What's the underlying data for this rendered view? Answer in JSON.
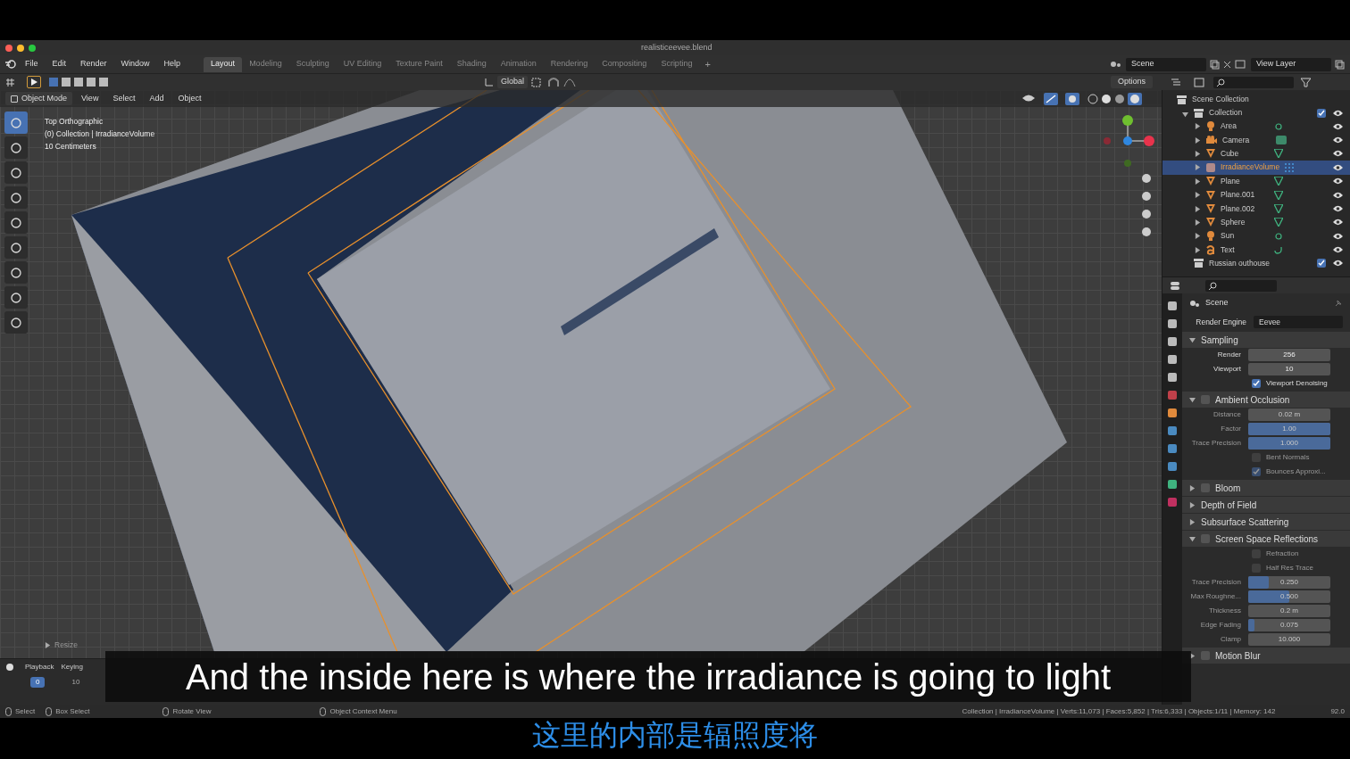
{
  "window": {
    "title": "realisticeevee.blend"
  },
  "menus": [
    "File",
    "Edit",
    "Render",
    "Window",
    "Help"
  ],
  "workspace_tabs": [
    {
      "label": "Layout",
      "selected": true
    },
    {
      "label": "Modeling",
      "selected": false
    },
    {
      "label": "Sculpting",
      "selected": false
    },
    {
      "label": "UV Editing",
      "selected": false
    },
    {
      "label": "Texture Paint",
      "selected": false
    },
    {
      "label": "Shading",
      "selected": false
    },
    {
      "label": "Animation",
      "selected": false
    },
    {
      "label": "Rendering",
      "selected": false
    },
    {
      "label": "Compositing",
      "selected": false
    },
    {
      "label": "Scripting",
      "selected": false
    }
  ],
  "add_tab": "+",
  "scene_field": "Scene",
  "view_layer_field": "View Layer",
  "tool_header": {
    "orientation": "Global",
    "options": "Options"
  },
  "viewport_header": {
    "mode": "Object Mode",
    "menus": [
      "View",
      "Select",
      "Add",
      "Object"
    ]
  },
  "viewport_info": [
    "Top Orthographic",
    "(0) Collection | IrradianceVolume",
    "10 Centimeters"
  ],
  "last_operator": "Resize",
  "timeline": {
    "menus": [
      "Playback",
      "Keying"
    ],
    "current_frame": "0",
    "frame_label": "10"
  },
  "outliner": {
    "root": "Scene Collection",
    "collections": [
      {
        "name": "Collection",
        "expanded": true,
        "checked": true,
        "children": [
          {
            "name": "Area",
            "kind": "light",
            "selected": false
          },
          {
            "name": "Camera",
            "kind": "camera",
            "selected": false
          },
          {
            "name": "Cube",
            "kind": "mesh",
            "selected": false
          },
          {
            "name": "IrradianceVolume",
            "kind": "probe",
            "selected": true
          },
          {
            "name": "Plane",
            "kind": "mesh",
            "selected": false
          },
          {
            "name": "Plane.001",
            "kind": "mesh",
            "selected": false
          },
          {
            "name": "Plane.002",
            "kind": "mesh",
            "selected": false
          },
          {
            "name": "Sphere",
            "kind": "mesh",
            "selected": false
          },
          {
            "name": "Sun",
            "kind": "light",
            "selected": false
          },
          {
            "name": "Text",
            "kind": "text",
            "selected": false
          }
        ]
      },
      {
        "name": "Russian outhouse",
        "expanded": false,
        "checked": true
      }
    ]
  },
  "properties": {
    "context": "Scene",
    "render_engine_label": "Render Engine",
    "render_engine": "Eevee",
    "rows": [
      {
        "kind": "panel",
        "label": "Sampling",
        "expanded": true
      },
      {
        "kind": "field",
        "label": "Render",
        "value": "256",
        "disabled": false
      },
      {
        "kind": "field",
        "label": "Viewport",
        "value": "10",
        "disabled": false
      },
      {
        "kind": "check",
        "label": "Viewport Denoising",
        "checked": true,
        "disabled": false
      },
      {
        "kind": "panel",
        "label": "Ambient Occlusion",
        "expanded": true,
        "checked": false
      },
      {
        "kind": "field",
        "label": "Distance",
        "value": "0.02 m",
        "disabled": true
      },
      {
        "kind": "slider",
        "label": "Factor",
        "value": "1.00",
        "level": 1,
        "disabled": true
      },
      {
        "kind": "slider",
        "label": "Trace Precision",
        "value": "1.000",
        "level": 1,
        "disabled": true
      },
      {
        "kind": "check",
        "label": "Bent Normals",
        "checked": false,
        "disabled": true
      },
      {
        "kind": "check",
        "label": "Bounces Approxi...",
        "checked": true,
        "disabled": true
      },
      {
        "kind": "panel",
        "label": "Bloom",
        "expanded": false,
        "checked": false
      },
      {
        "kind": "panel",
        "label": "Depth of Field",
        "expanded": false
      },
      {
        "kind": "panel",
        "label": "Subsurface Scattering",
        "expanded": false
      },
      {
        "kind": "panel",
        "label": "Screen Space Reflections",
        "expanded": true,
        "checked": false
      },
      {
        "kind": "check",
        "label": "Refraction",
        "checked": false,
        "disabled": true
      },
      {
        "kind": "check",
        "label": "Half Res Trace",
        "checked": false,
        "disabled": true
      },
      {
        "kind": "slider",
        "label": "Trace Precision",
        "value": "0.250",
        "level": 0.25,
        "disabled": true
      },
      {
        "kind": "slider",
        "label": "Max Roughne...",
        "value": "0.500",
        "level": 0.5,
        "disabled": true
      },
      {
        "kind": "field",
        "label": "Thickness",
        "value": "0.2 m",
        "disabled": true
      },
      {
        "kind": "slider",
        "label": "Edge Fading",
        "value": "0.075",
        "level": 0.075,
        "disabled": true
      },
      {
        "kind": "field",
        "label": "Clamp",
        "value": "10.000",
        "disabled": true
      },
      {
        "kind": "panel",
        "label": "Motion Blur",
        "expanded": false,
        "checked": false
      }
    ]
  },
  "status_bar": {
    "hints": [
      {
        "kind": "mouse",
        "label": "Select"
      },
      {
        "kind": "mouse",
        "label": "Box Select"
      },
      {
        "kind": "mouse",
        "label": "Rotate View"
      },
      {
        "kind": "mouse",
        "label": "Object Context Menu"
      }
    ],
    "stats": "Collection | IrradianceVolume | Verts:11,073 | Faces:5,852 | Tris:6,333 | Objects:1/11 | Memory: 142",
    "version": "92.0"
  },
  "subtitles": {
    "english": "And the inside here is where the irradiance is going to light",
    "chinese": "这里的内部是辐照度将"
  }
}
